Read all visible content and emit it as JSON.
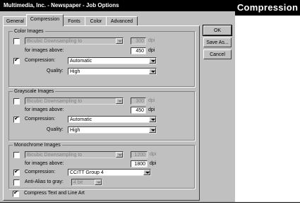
{
  "window": {
    "title": "Multimedia, Inc. - Newspaper - Job Options"
  },
  "heading": "Compression",
  "tabs": [
    {
      "label": "General",
      "active": false
    },
    {
      "label": "Compression",
      "active": true
    },
    {
      "label": "Fonts",
      "active": false
    },
    {
      "label": "Color",
      "active": false
    },
    {
      "label": "Advanced",
      "active": false
    }
  ],
  "buttons": {
    "ok": "OK",
    "save_as": "Save As...",
    "cancel": "Cancel"
  },
  "color_images": {
    "title": "Color Images",
    "downsample_checked": false,
    "downsample_method": "Bicubic Downsampling to",
    "downsample_dpi": "300",
    "dpi_unit": "dpi",
    "images_above_label": "for images above:",
    "images_above_dpi": "450",
    "compression_checked": true,
    "compression_label": "Compression:",
    "compression_value": "Automatic",
    "quality_label": "Quality:",
    "quality_value": "High"
  },
  "grayscale_images": {
    "title": "Grayscale Images",
    "downsample_checked": false,
    "downsample_method": "Bicubic Downsampling to",
    "downsample_dpi": "300",
    "dpi_unit": "dpi",
    "images_above_label": "for images above:",
    "images_above_dpi": "450",
    "compression_checked": true,
    "compression_label": "Compression:",
    "compression_value": "Automatic",
    "quality_label": "Quality:",
    "quality_value": "High"
  },
  "monochrome_images": {
    "title": "Monochrome Images",
    "downsample_checked": false,
    "downsample_method": "Bicubic Downsampling to",
    "downsample_dpi": "1200",
    "dpi_unit": "dpi",
    "images_above_label": "for images above:",
    "images_above_dpi": "1800",
    "compression_checked": true,
    "compression_label": "Compression:",
    "compression_value": "CCITT Group 4",
    "antialias_checked": false,
    "antialias_label": "Anti-Alias to gray:",
    "antialias_value": "4 bit"
  },
  "compress_text": {
    "checked": true,
    "label": "Compress Text and Line Art"
  },
  "check_mark": "✔"
}
